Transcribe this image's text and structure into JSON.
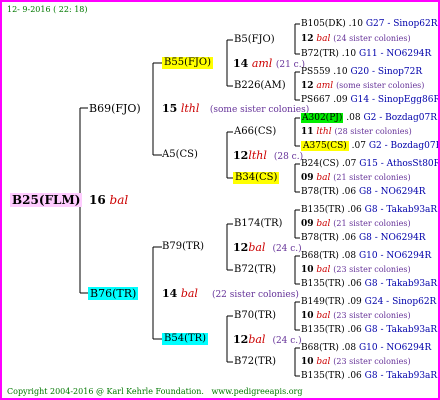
{
  "header": {
    "date": "12-  9-2016 ( 22: 18)"
  },
  "footer": {
    "copyright": "Copyright 2004-2016 @ Karl Kehrle Foundation.",
    "url": "www.pedigreeapis.org"
  },
  "root": {
    "label": "B25(FLM)",
    "num": "16",
    "race": "bal"
  },
  "gen1": [
    {
      "label": "B69(FJO)",
      "num": "15",
      "race": "lthl",
      "note": "(some sister colonies)"
    },
    {
      "label": "B76(TR)",
      "num": "14",
      "race": "bal",
      "note": "(22 sister colonies)"
    }
  ],
  "gen2": [
    {
      "label": "B55(FJO)",
      "num": "14",
      "race": "aml",
      "note": "(21 c.)"
    },
    {
      "label": "A5(CS)",
      "num": "12",
      "race": "lthl",
      "note": "(28 c.)"
    },
    {
      "label": "B79(TR)",
      "num": "12",
      "race": "bal",
      "note": "(24 c.)"
    },
    {
      "label": "B54(TR)",
      "num": "12",
      "race": "bal",
      "note": "(24 c.)"
    }
  ],
  "gen3": [
    {
      "label": "B5(FJO)"
    },
    {
      "label": "B226(AM)"
    },
    {
      "label": "A66(CS)"
    },
    {
      "label": "B34(CS)"
    },
    {
      "label": "B174(TR)"
    },
    {
      "label": "B72(TR)"
    },
    {
      "label": "B70(TR)"
    },
    {
      "label": "B72(TR)"
    }
  ],
  "gen4": [
    {
      "top": "B105(DK)",
      "top_pct": ".10",
      "top_ref": "G27 - Sinop62R",
      "num": "12",
      "race": "bal",
      "note": "(24 sister colonies)",
      "bot": "B72(TR)",
      "bot_pct": ".10",
      "bot_ref": "G11 - NO6294R"
    },
    {
      "top": "PS559",
      "top_pct": ".10",
      "top_ref": "G20 - Sinop72R",
      "num": "12",
      "race": "aml",
      "note": "(some sister colonies)",
      "bot": "PS667",
      "bot_pct": ".09",
      "bot_ref": "G14 - SinopEgg86R"
    },
    {
      "top": "A302(PJ)",
      "top_pct": ".08",
      "top_ref": "G2 - Bozdag07R",
      "num": "11",
      "race": "lthl",
      "note": "(28 sister colonies)",
      "bot": "A375(CS)",
      "bot_pct": ".07",
      "bot_ref": "G2 - Bozdag07R"
    },
    {
      "top": "B24(CS)",
      "top_pct": ".07",
      "top_ref": "G15 - AthosSt80R",
      "num": "09",
      "race": "bal",
      "note": "(21 sister colonies)",
      "bot": "B78(TR)",
      "bot_pct": ".06",
      "bot_ref": "G8 - NO6294R"
    },
    {
      "top": "B135(TR)",
      "top_pct": ".06",
      "top_ref": "G8 - Takab93aR",
      "num": "09",
      "race": "bal",
      "note": "(21 sister colonies)",
      "bot": "B78(TR)",
      "bot_pct": ".06",
      "bot_ref": "G8 - NO6294R"
    },
    {
      "top": "B68(TR)",
      "top_pct": ".08",
      "top_ref": "G10 - NO6294R",
      "num": "10",
      "race": "bal",
      "note": "(23 sister colonies)",
      "bot": "B135(TR)",
      "bot_pct": ".06",
      "bot_ref": "G8 - Takab93aR"
    },
    {
      "top": "B149(TR)",
      "top_pct": ".09",
      "top_ref": "G24 - Sinop62R",
      "num": "10",
      "race": "bal",
      "note": "(23 sister colonies)",
      "bot": "B135(TR)",
      "bot_pct": ".06",
      "bot_ref": "G8 - Takab93aR"
    },
    {
      "top": "B68(TR)",
      "top_pct": ".08",
      "top_ref": "G10 - NO6294R",
      "num": "10",
      "race": "bal",
      "note": "(23 sister colonies)",
      "bot": "B135(TR)",
      "bot_pct": ".06",
      "bot_ref": "G8 - Takab93aR"
    }
  ],
  "colors": {
    "border": "#ff00ff",
    "highlight_yellow": "#ffff00",
    "highlight_cyan": "#00ffff",
    "highlight_pink": "#ffccff",
    "highlight_green": "#00ee00",
    "ref_text": "#0000aa",
    "note_text": "#663399",
    "race_text": "#cc0000",
    "footer_text": "#007700"
  }
}
